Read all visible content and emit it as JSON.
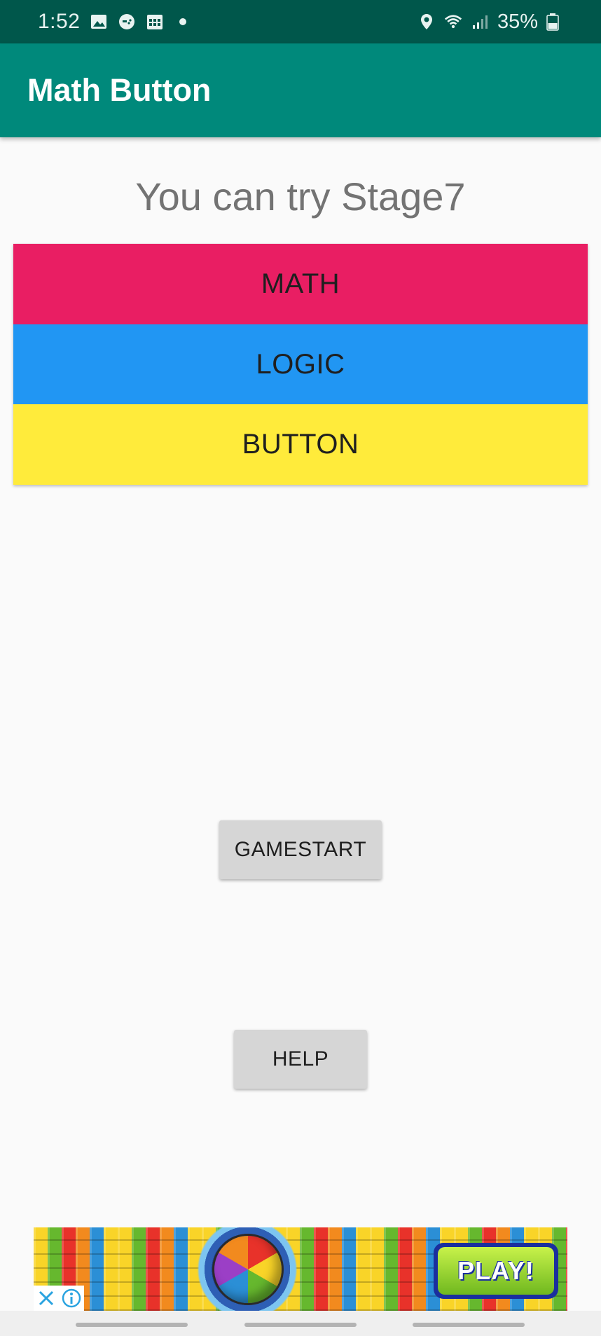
{
  "status_bar": {
    "time": "1:52",
    "battery_text": "35%",
    "icons_left": [
      "image-icon",
      "game-icon",
      "calendar-icon",
      "dot-icon"
    ],
    "icons_right": [
      "location-icon",
      "wifi-icon",
      "signal-icon",
      "battery-icon"
    ]
  },
  "app_bar": {
    "title": "Math Button",
    "color": "#00897b"
  },
  "main": {
    "stage_text": "You can try Stage7",
    "color_buttons": [
      {
        "label": "MATH",
        "color": "#e91e63"
      },
      {
        "label": "LOGIC",
        "color": "#2196f3"
      },
      {
        "label": "BUTTON",
        "color": "#ffeb3b"
      }
    ],
    "gamestart_label": "GAMESTART",
    "help_label": "HELP"
  },
  "ad": {
    "play_label": "PLAY!",
    "controls": [
      "close-icon",
      "info-icon"
    ]
  }
}
